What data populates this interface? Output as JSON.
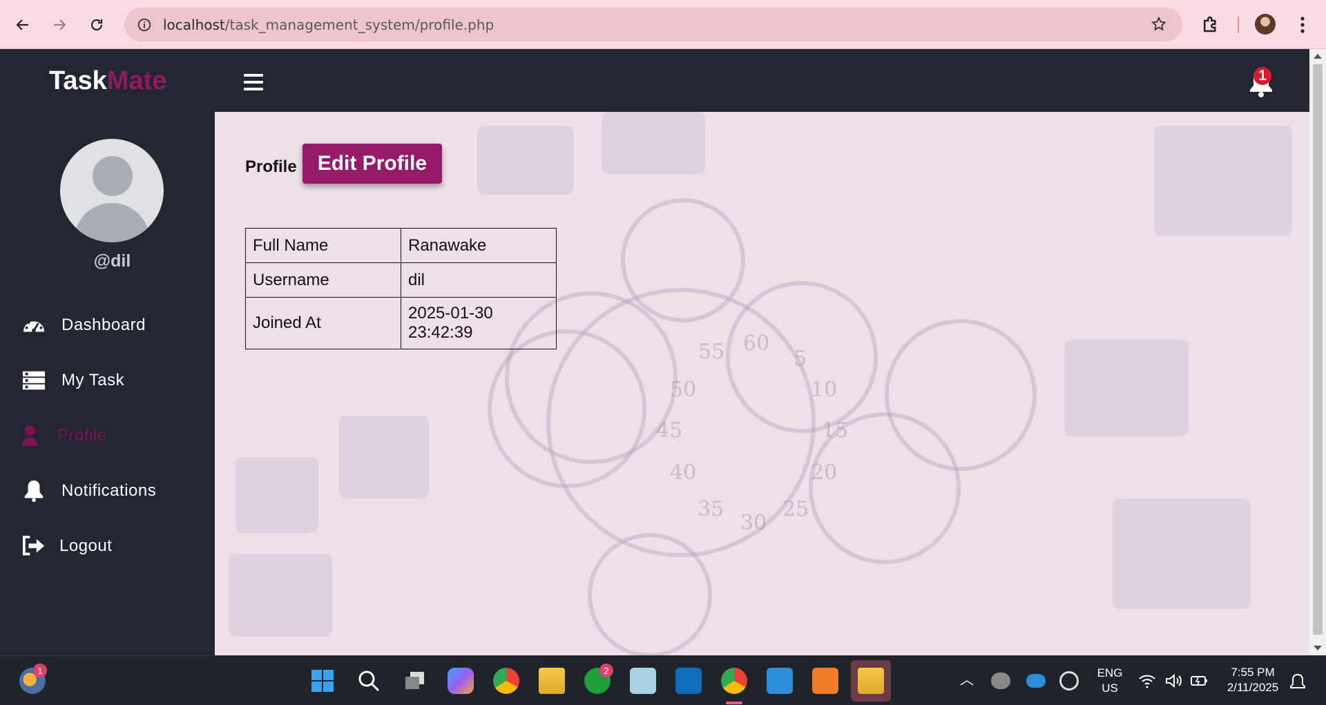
{
  "browser": {
    "url_host": "localhost",
    "url_path": "/task_management_system/profile.php"
  },
  "app": {
    "logo_part1": "Task",
    "logo_part2": "Mate",
    "notification_count": "1",
    "accent_color": "#8d1a62",
    "sidebar_color": "#232631"
  },
  "sidebar": {
    "handle": "@dil",
    "items": [
      {
        "label": "Dashboard",
        "icon": "dashboard-gauge-icon"
      },
      {
        "label": "My Task",
        "icon": "task-list-icon"
      },
      {
        "label": "Profile",
        "icon": "user-icon",
        "active": true
      },
      {
        "label": "Notifications",
        "icon": "bell-icon"
      },
      {
        "label": "Logout",
        "icon": "logout-icon"
      }
    ]
  },
  "main": {
    "heading": "Profile",
    "edit_button": "Edit Profile",
    "profile_table": {
      "rows": [
        {
          "label": "Full Name",
          "value": "Ranawake"
        },
        {
          "label": "Username",
          "value": "dil"
        },
        {
          "label": "Joined At",
          "value": "2025-01-30 23:42:39"
        }
      ]
    }
  },
  "taskbar": {
    "weather_badge": "1",
    "xbox_badge": "2",
    "language": "ENG",
    "region": "US",
    "time": "7:55 PM",
    "date": "2/11/2025"
  }
}
